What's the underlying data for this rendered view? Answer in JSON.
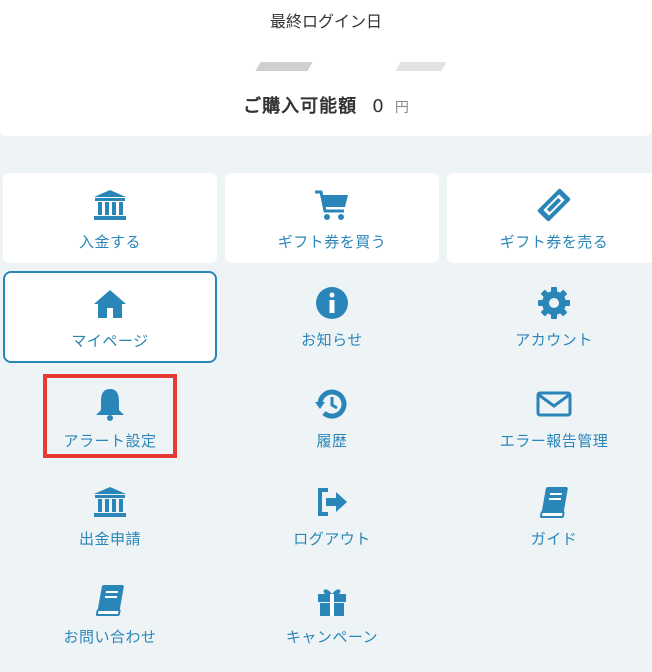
{
  "header": {
    "last_login_label": "最終ログイン日",
    "purchase_label": "ご購入可能額",
    "purchase_amount": "0",
    "purchase_unit": "円"
  },
  "menu": {
    "deposit": "入金する",
    "buy_gift": "ギフト券を買う",
    "sell_gift": "ギフト券を売る",
    "mypage": "マイページ",
    "notice": "お知らせ",
    "account": "アカウント",
    "alert": "アラート設定",
    "history": "履歴",
    "error_report": "エラー報告管理",
    "withdraw": "出金申請",
    "logout": "ログアウト",
    "guide": "ガイド",
    "contact": "お問い合わせ",
    "campaign": "キャンペーン"
  },
  "colors": {
    "accent": "#2a86b8",
    "highlight": "#e53a36",
    "background": "#eef3f6"
  },
  "icons": {
    "deposit": "bank-icon",
    "buy_gift": "cart-icon",
    "sell_gift": "ticket-icon",
    "mypage": "home-icon",
    "notice": "info-icon",
    "account": "gear-icon",
    "alert": "bell-icon",
    "history": "history-icon",
    "error_report": "envelope-icon",
    "withdraw": "bank-icon",
    "logout": "logout-icon",
    "guide": "book-icon",
    "contact": "book-icon",
    "campaign": "gift-icon"
  }
}
